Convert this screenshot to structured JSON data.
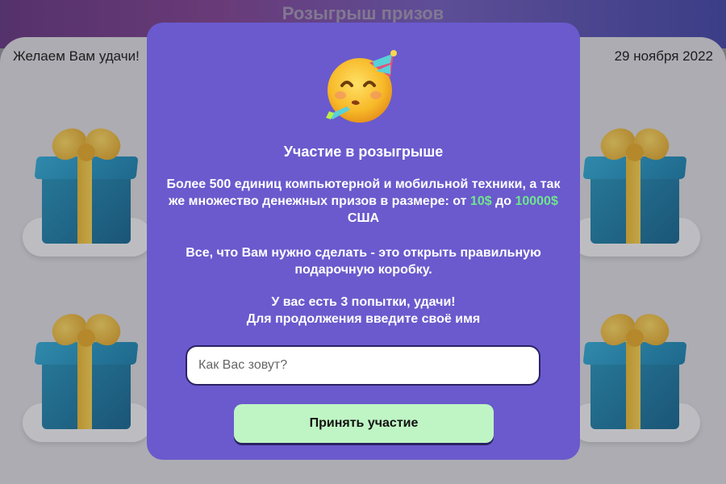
{
  "page": {
    "title": "Розыгрыш призов",
    "wish": "Желаем Вам удачи!",
    "date": "29 ноября 2022"
  },
  "gifts": [
    {
      "id": "gift-top-left"
    },
    {
      "id": "gift-top-right"
    },
    {
      "id": "gift-bottom-left"
    },
    {
      "id": "gift-bottom-right"
    }
  ],
  "modal": {
    "icon": "party-face-emoji",
    "title": "Участие в розыгрыше",
    "p1_text_a": "Более 500 единиц компьютерной и мобильной техники, а так же множество денежных призов в размере: от ",
    "p1_amount_min": "10$",
    "p1_text_b": " до ",
    "p1_amount_max": "10000$",
    "p1_text_c": " США",
    "p2": "Все, что Вам нужно сделать - это открыть правильную подарочную коробку.",
    "p3_line1": "У вас есть 3 попытки, удачи!",
    "p3_line2": "Для продолжения введите своё имя",
    "name_placeholder": "Как Вас зовут?",
    "name_value": "",
    "submit_label": "Принять участие"
  },
  "colors": {
    "modal_bg": "#6a5acd",
    "accent_green": "#6fe58e",
    "button_bg": "#bff5c4"
  }
}
